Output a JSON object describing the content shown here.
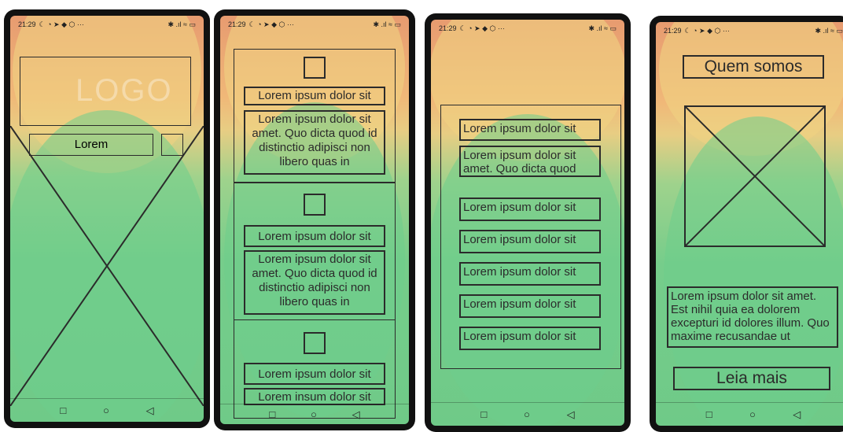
{
  "status": {
    "time": "21:29",
    "left_icons": "☾ ◔ ➤ ◆ ⬡ ···",
    "right_icons": "✱ .ıl ≈ ▭"
  },
  "nav": {
    "recent_icon": "square-icon",
    "home_icon": "circle-icon",
    "back_icon": "triangle-icon"
  },
  "screen1": {
    "logo": "LOGO",
    "menu_button": "Lorem"
  },
  "screen2": {
    "cards": [
      {
        "title": "Lorem ipsum dolor sit",
        "body": "Lorem ipsum dolor sit amet. Quo dicta quod id distinctio adipisci non libero quas in"
      },
      {
        "title": "Lorem ipsum dolor sit",
        "body": "Lorem ipsum dolor sit amet. Quo dicta quod id distinctio adipisci non libero quas in"
      },
      {
        "title": "Lorem ipsum dolor sit",
        "body": "Lorem insum dolor sit"
      }
    ]
  },
  "screen3": {
    "first_item": "Lorem ipsum dolor sit",
    "description": "Lorem ipsum dolor sit amet. Quo dicta quod",
    "items": [
      "Lorem ipsum dolor sit",
      "Lorem ipsum dolor sit",
      "Lorem ipsum dolor sit",
      "Lorem ipsum dolor sit",
      "Lorem ipsum dolor sit"
    ]
  },
  "screen4": {
    "title": "Quem somos",
    "paragraph": "Lorem ipsum dolor sit amet. Est nihil quia ea dolorem excepturi id dolores illum. Quo maxime recusandae ut",
    "button": "Leia mais"
  }
}
